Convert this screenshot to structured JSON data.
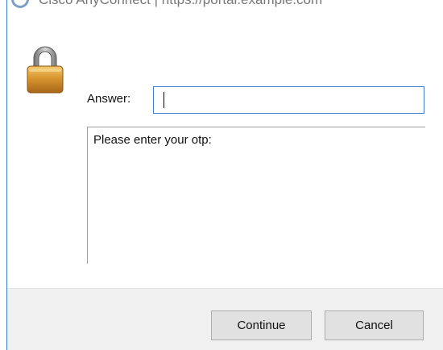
{
  "window": {
    "title": "Cisco AnyConnect | https://portal.example.com"
  },
  "prompt": {
    "answer_label": "Answer:",
    "answer_value": "",
    "message": "Please enter your otp:"
  },
  "buttons": {
    "continue_label": "Continue",
    "cancel_label": "Cancel"
  },
  "icons": {
    "lock": "padlock-icon",
    "app": "anyconnect-icon"
  },
  "colors": {
    "accent": "#3d7bd6",
    "footer_bg": "#f0f0f0",
    "button_bg": "#e1e1e1",
    "lock_body": "#d99b3a",
    "lock_shackle": "#9a9a9a"
  }
}
